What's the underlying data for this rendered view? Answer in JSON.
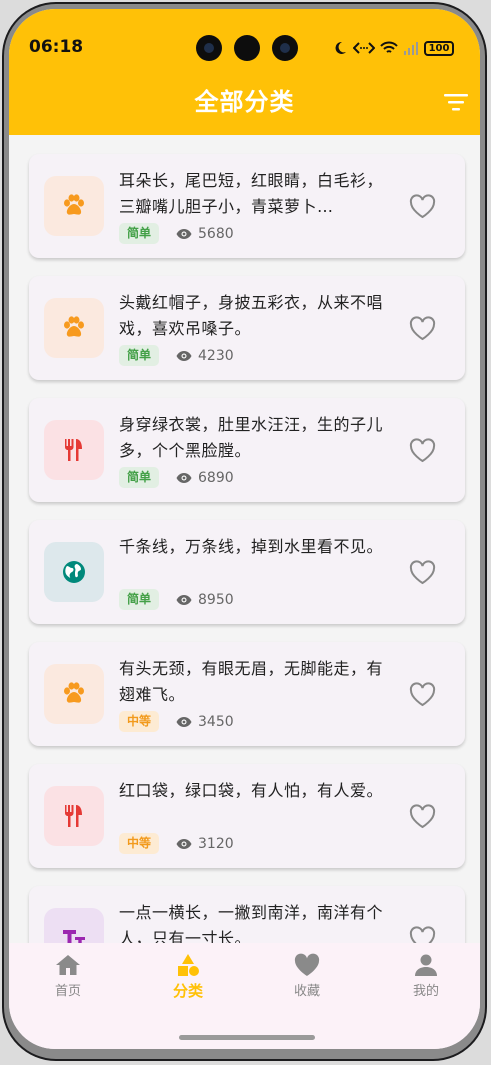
{
  "status_bar": {
    "time": "06:18",
    "battery": "100"
  },
  "header": {
    "title": "全部分类"
  },
  "colors": {
    "accent": "#ffc107",
    "easy": "#43a047",
    "medium": "#f29a1c"
  },
  "riddles": [
    {
      "text": "耳朵长，尾巴短，红眼睛，白毛衫，三瓣嘴儿胆子小，青菜萝卜…",
      "difficulty": "简单",
      "level": "easy",
      "views": "5680",
      "icon": "paw-icon"
    },
    {
      "text": "头戴红帽子，身披五彩衣，从来不唱戏，喜欢吊嗓子。",
      "difficulty": "简单",
      "level": "easy",
      "views": "4230",
      "icon": "paw-icon"
    },
    {
      "text": "身穿绿衣裳，肚里水汪汪，生的子儿多，个个黑脸膛。",
      "difficulty": "简单",
      "level": "easy",
      "views": "6890",
      "icon": "utensils-icon"
    },
    {
      "text": "千条线，万条线，掉到水里看不见。",
      "difficulty": "简单",
      "level": "easy",
      "views": "8950",
      "icon": "globe-icon"
    },
    {
      "text": "有头无颈，有眼无眉，无脚能走，有翅难飞。",
      "difficulty": "中等",
      "level": "medium",
      "views": "3450",
      "icon": "paw-icon"
    },
    {
      "text": "红口袋，绿口袋，有人怕，有人爱。",
      "difficulty": "中等",
      "level": "medium",
      "views": "3120",
      "icon": "utensils-icon"
    },
    {
      "text": "一点一横长，一撇到南洋，南洋有个人，只有一寸长。",
      "difficulty": "",
      "level": "",
      "views": "",
      "icon": "text-format-icon"
    }
  ],
  "tabs": [
    {
      "label": "首页",
      "icon": "home-icon",
      "active": false
    },
    {
      "label": "分类",
      "icon": "category-icon",
      "active": true
    },
    {
      "label": "收藏",
      "icon": "heart-icon",
      "active": false
    },
    {
      "label": "我的",
      "icon": "person-icon",
      "active": false
    }
  ]
}
